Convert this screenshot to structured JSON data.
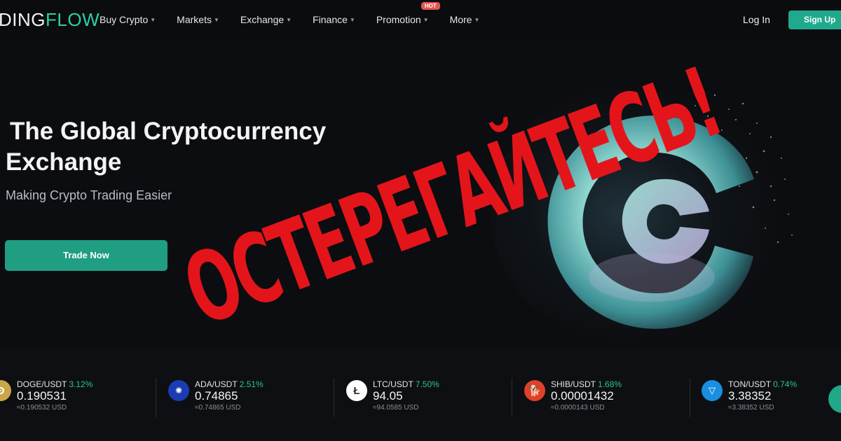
{
  "brand": {
    "part1": "DING",
    "part2": "FLOW"
  },
  "nav": {
    "menu": [
      {
        "label": "Buy Crypto"
      },
      {
        "label": "Markets"
      },
      {
        "label": "Exchange"
      },
      {
        "label": "Finance"
      },
      {
        "label": "Promotion",
        "badge": "HOT"
      },
      {
        "label": "More"
      }
    ],
    "login": "Log In",
    "signup": "Sign Up"
  },
  "hero": {
    "title_line1": "The Global Cryptocurrency",
    "title_line2": "Exchange",
    "subtitle": "Making Crypto Trading Easier",
    "cta": "Trade Now"
  },
  "overlay_text": "ОСТЕРЕГАЙТЕСЬ!",
  "ticker": [
    {
      "pair": "DOGE/USDT",
      "change": "3.12%",
      "price": "0.190531",
      "usd": "≈0.190532 USD",
      "icon": "doge-icon"
    },
    {
      "pair": "ADA/USDT",
      "change": "2.51%",
      "price": "0.74865",
      "usd": "≈0.74865 USD",
      "icon": "ada-icon"
    },
    {
      "pair": "LTC/USDT",
      "change": "7.50%",
      "price": "94.05",
      "usd": "≈94.0585 USD",
      "icon": "ltc-icon"
    },
    {
      "pair": "SHIB/USDT",
      "change": "1.68%",
      "price": "0.00001432",
      "usd": "≈0.0000143 USD",
      "icon": "shib-icon"
    },
    {
      "pair": "TON/USDT",
      "change": "0.74%",
      "price": "3.38352",
      "usd": "≈3.38352 USD",
      "icon": "ton-icon"
    }
  ],
  "colors": {
    "accent": "#1f9e83",
    "positive": "#2bc48a",
    "warning_overlay": "#e3151b",
    "background": "#0b0c0e"
  }
}
